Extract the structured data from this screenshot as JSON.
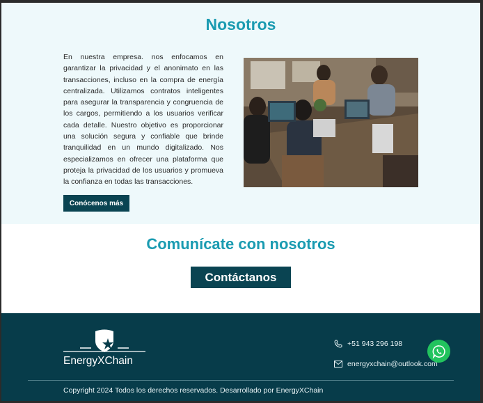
{
  "about": {
    "title": "Nosotros",
    "text": "En nuestra empresa. nos enfocamos en garantizar la privacidad y el anonimato en las transacciones, incluso en la compra de energía centralizada. Utilizamos contratos inteligentes para asegurar la transparencia y congruencia de los cargos, permitiendo a los usuarios verificar cada detalle. Nuestro objetivo es proporcionar una solución segura y confiable que brinde tranquilidad en un mundo digitalizado. Nos especializamos en ofrecer una plataforma que proteja la privacidad de los usuarios y promueva la confianza en todas las transacciones.",
    "button_label": "Conócenos más"
  },
  "contact": {
    "title": "Comunícate con nosotros",
    "button_label": "Contáctanos"
  },
  "footer": {
    "logo_text": "EnergyXChain",
    "phone": "+51 943 296 198",
    "email": "energyxchain@outlook.com",
    "copyright": "Copyright 2024 Todos los derechos reservados. Desarrollado por EnergyXChain"
  },
  "icons": {
    "phone": "phone-icon",
    "email": "mail-icon",
    "whatsapp": "whatsapp-icon",
    "logo": "shield-star-icon"
  },
  "colors": {
    "accent": "#1a9bb1",
    "dark": "#0a4452",
    "footer_bg": "#073c4a",
    "about_bg": "#eef9fb",
    "whatsapp": "#22c35e"
  }
}
